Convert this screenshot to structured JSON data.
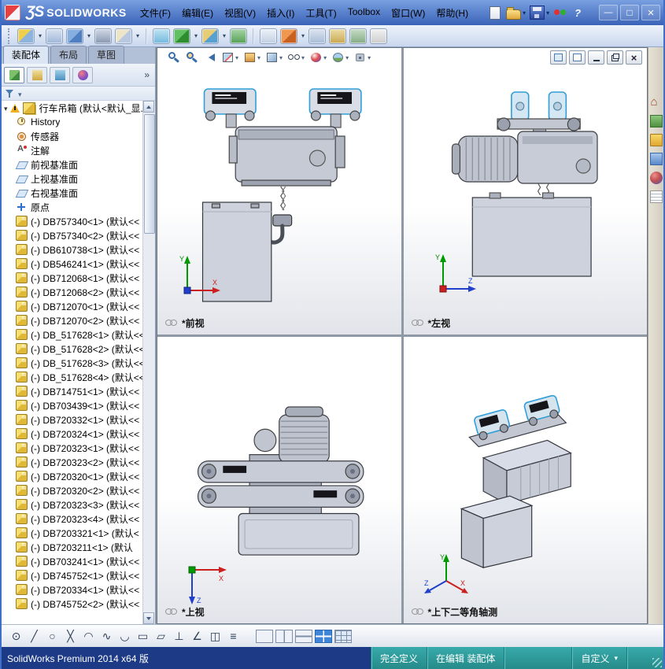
{
  "titlebar": {
    "logo_glyph": "ƷS",
    "logo_text": "SOLIDWORKS",
    "menus": [
      "文件(F)",
      "编辑(E)",
      "视图(V)",
      "插入(I)",
      "工具(T)",
      "Toolbox",
      "窗口(W)",
      "帮助(H)"
    ],
    "quick_icons": [
      {
        "name": "new-document-icon",
        "kind": "new"
      },
      {
        "name": "open-icon",
        "kind": "open",
        "drop": true
      },
      {
        "name": "save-icon",
        "kind": "save",
        "drop": true
      },
      {
        "name": "options-toggle-icon",
        "kind": "swtoggle"
      },
      {
        "name": "help-icon",
        "kind": "help"
      }
    ],
    "window_buttons": [
      {
        "name": "minimize-button",
        "kind": "min"
      },
      {
        "name": "maximize-button",
        "kind": "max"
      },
      {
        "name": "close-button",
        "kind": "close"
      }
    ]
  },
  "toolbar": {
    "icons": [
      {
        "name": "insert-components-icon",
        "bg": "linear-gradient(135deg,#f0d04a 45%,#8fb4dc 45%)",
        "drop": true
      },
      {
        "name": "mate-icon",
        "bg": "linear-gradient(#d8e2f0,#9fb6d8)"
      },
      {
        "name": "linear-component-pattern-icon",
        "bg": "linear-gradient(135deg,#86aede 50%,#4f7fc0 50%)",
        "drop": true
      },
      {
        "name": "smart-fasteners-icon",
        "bg": "linear-gradient(#d0d8e6,#8898b0)"
      },
      {
        "name": "move-component-icon",
        "bg": "linear-gradient(135deg,#ece5c8 50%,#b8c8e0 50%)",
        "drop": true
      },
      {
        "name": "separator",
        "kind": "sep"
      },
      {
        "name": "show-hidden-components-icon",
        "bg": "linear-gradient(#bfe3f2,#74b8dc)"
      },
      {
        "name": "assembly-features-icon",
        "bg": "linear-gradient(135deg,#62c062 50%,#2e8e2e 50%)",
        "drop": true
      },
      {
        "name": "reference-geometry-icon",
        "bg": "linear-gradient(135deg,#e6cc74 50%,#58a0d0 50%)",
        "drop": true
      },
      {
        "name": "new-motion-study-icon",
        "bg": "linear-gradient(#a6d4a6,#55a055)"
      },
      {
        "name": "separator",
        "kind": "sep"
      },
      {
        "name": "bill-of-materials-icon",
        "bg": "linear-gradient(#eef2f8,#c0cee2)"
      },
      {
        "name": "exploded-view-icon",
        "bg": "linear-gradient(135deg,#f09850 50%,#c86020 50%)",
        "drop": true
      },
      {
        "name": "instant3d-icon",
        "bg": "linear-gradient(#dce4f0,#a8bcd8)"
      },
      {
        "name": "measure-icon",
        "bg": "linear-gradient(#ecdca6,#c8a850)"
      },
      {
        "name": "interference-detection-icon",
        "bg": "linear-gradient(#c6dcc6,#84ac84)"
      },
      {
        "name": "spell-checker-icon",
        "bg": "linear-gradient(#f2f2f2,#cccccc)"
      }
    ]
  },
  "tabs": {
    "items": [
      {
        "label": "装配体",
        "active": true
      },
      {
        "label": "布局"
      },
      {
        "label": "草图"
      }
    ]
  },
  "panel": {
    "tree_tabs": [
      {
        "name": "featuremanager-tab",
        "kind": "fm",
        "active": true
      },
      {
        "name": "propertymanager-tab",
        "kind": "pm"
      },
      {
        "name": "configurationmanager-tab",
        "kind": "cm"
      },
      {
        "name": "displaymanager-tab",
        "kind": "dm"
      }
    ],
    "chevron": "»",
    "root_label": "行车吊箱 (默认<默认_显...",
    "items": [
      {
        "icon": "history",
        "label": "History"
      },
      {
        "icon": "sensors",
        "label": "传感器"
      },
      {
        "icon": "annotations",
        "label": "注解"
      },
      {
        "icon": "plane",
        "label": "前视基准面"
      },
      {
        "icon": "plane",
        "label": "上视基准面"
      },
      {
        "icon": "plane",
        "label": "右视基准面"
      },
      {
        "icon": "origin",
        "label": "原点"
      },
      {
        "icon": "component",
        "label": "(-) DB757340<1> (默认<<"
      },
      {
        "icon": "component",
        "label": "(-) DB757340<2> (默认<<"
      },
      {
        "icon": "component",
        "label": "(-) DB610738<1> (默认<<"
      },
      {
        "icon": "component",
        "label": "(-) DB546241<1> (默认<<"
      },
      {
        "icon": "component",
        "label": "(-) DB712068<1> (默认<<"
      },
      {
        "icon": "component",
        "label": "(-) DB712068<2> (默认<<"
      },
      {
        "icon": "component",
        "label": "(-) DB712070<1> (默认<<"
      },
      {
        "icon": "component",
        "label": "(-) DB712070<2> (默认<<"
      },
      {
        "icon": "component",
        "label": "(-) DB_517628<1> (默认<<"
      },
      {
        "icon": "component",
        "label": "(-) DB_517628<2> (默认<<"
      },
      {
        "icon": "component",
        "label": "(-) DB_517628<3> (默认<<"
      },
      {
        "icon": "component",
        "label": "(-) DB_517628<4> (默认<<"
      },
      {
        "icon": "component",
        "label": "(-) DB714751<1> (默认<<"
      },
      {
        "icon": "component",
        "label": "(-) DB703439<1> (默认<<"
      },
      {
        "icon": "component",
        "label": "(-) DB720332<1> (默认<<"
      },
      {
        "icon": "component",
        "label": "(-) DB720324<1> (默认<<"
      },
      {
        "icon": "component",
        "label": "(-) DB720323<1> (默认<<"
      },
      {
        "icon": "component",
        "label": "(-) DB720323<2> (默认<<"
      },
      {
        "icon": "component",
        "label": "(-) DB720320<1> (默认<<"
      },
      {
        "icon": "component",
        "label": "(-) DB720320<2> (默认<<"
      },
      {
        "icon": "component",
        "label": "(-) DB720323<3> (默认<<"
      },
      {
        "icon": "component",
        "label": "(-) DB720323<4> (默认<<"
      },
      {
        "icon": "component",
        "label": "(-) DB7203321<1> (默认<"
      },
      {
        "icon": "component",
        "label": "(-) DB7203211<1> (默认"
      },
      {
        "icon": "component",
        "label": "(-) DB703241<1> (默认<<"
      },
      {
        "icon": "component",
        "label": "(-) DB745752<1> (默认<<"
      },
      {
        "icon": "component",
        "label": "(-) DB720334<1> (默认<<"
      },
      {
        "icon": "component",
        "label": "(-) DB745752<2> (默认<<"
      }
    ]
  },
  "viewport": {
    "toolbar_icons": [
      {
        "name": "zoom-to-fit-icon",
        "kind": "mag"
      },
      {
        "name": "zoom-to-area-icon",
        "kind": "magarea"
      },
      {
        "name": "previous-view-icon",
        "kind": "prev"
      },
      {
        "name": "section-view-icon",
        "kind": "section",
        "drop": true
      },
      {
        "name": "view-orientation-icon",
        "kind": "cube",
        "drop": true
      },
      {
        "name": "display-style-icon",
        "kind": "shaded",
        "drop": true
      },
      {
        "name": "hide-show-items-icon",
        "kind": "glasses",
        "drop": true
      },
      {
        "name": "edit-appearance-icon",
        "kind": "ball",
        "drop": true
      },
      {
        "name": "apply-scene-icon",
        "kind": "scene",
        "drop": true
      },
      {
        "name": "view-settings-icon",
        "kind": "gear",
        "drop": true
      }
    ],
    "controls": [
      {
        "name": "pane-left-icon",
        "kind": "pane1"
      },
      {
        "name": "pane-right-icon",
        "kind": "pane2"
      },
      {
        "name": "minimize-document-button",
        "kind": "min"
      },
      {
        "name": "restore-document-button",
        "kind": "restore"
      },
      {
        "name": "close-document-button",
        "kind": "close"
      }
    ],
    "views": [
      {
        "label": "*前视"
      },
      {
        "label": "*左视"
      },
      {
        "label": "*上视"
      },
      {
        "label": "*上下二等角轴测"
      }
    ],
    "triad": {
      "x": "X",
      "y": "Y",
      "z": "Z"
    }
  },
  "taskpane": {
    "icons": [
      {
        "name": "solidworks-resources-icon",
        "kind": "home"
      },
      {
        "name": "design-library-icon",
        "kind": "library"
      },
      {
        "name": "file-explorer-icon",
        "kind": "folder"
      },
      {
        "name": "view-palette-icon",
        "kind": "palette"
      },
      {
        "name": "appearances-icon",
        "kind": "appearance"
      },
      {
        "name": "custom-properties-icon",
        "kind": "props"
      }
    ]
  },
  "sketchbar": {
    "icons": [
      {
        "name": "point-icon",
        "glyph": "⊙"
      },
      {
        "name": "line-icon",
        "glyph": "╱"
      },
      {
        "name": "circle-icon",
        "glyph": "○"
      },
      {
        "name": "trim-entities-icon",
        "glyph": "╳"
      },
      {
        "name": "ellipse-icon",
        "glyph": "◠"
      },
      {
        "name": "spline-icon",
        "glyph": "∿"
      },
      {
        "name": "arc-icon",
        "glyph": "◡"
      },
      {
        "name": "rectangle-icon",
        "glyph": "▭"
      },
      {
        "name": "parallelogram-icon",
        "glyph": "▱"
      },
      {
        "name": "perpendicular-icon",
        "glyph": "⊥"
      },
      {
        "name": "angle-icon",
        "glyph": "∠"
      },
      {
        "name": "mirror-entities-icon",
        "glyph": "◫"
      },
      {
        "name": "linear-sketch-pattern-icon",
        "glyph": "≡"
      }
    ],
    "layout_buttons": [
      {
        "name": "single-view-button",
        "kind": "one"
      },
      {
        "name": "two-view-vertical-button",
        "kind": "twov"
      },
      {
        "name": "two-view-horizontal-button",
        "kind": "twoh"
      },
      {
        "name": "four-view-button",
        "kind": "four",
        "active": true
      },
      {
        "name": "view-table-button",
        "kind": "table"
      }
    ]
  },
  "statusbar": {
    "left": "SolidWorks Premium 2014 x64 版",
    "fully_defined": "完全定义",
    "editing": "在编辑 装配体",
    "custom": "自定义"
  },
  "colors": {
    "accent_blue": "#2f9ed8",
    "title_blue": "#3a63b8",
    "status_teal": "#2f9e9e",
    "status_navy": "#1c3a86",
    "model_gray": "#c9cdd8"
  }
}
